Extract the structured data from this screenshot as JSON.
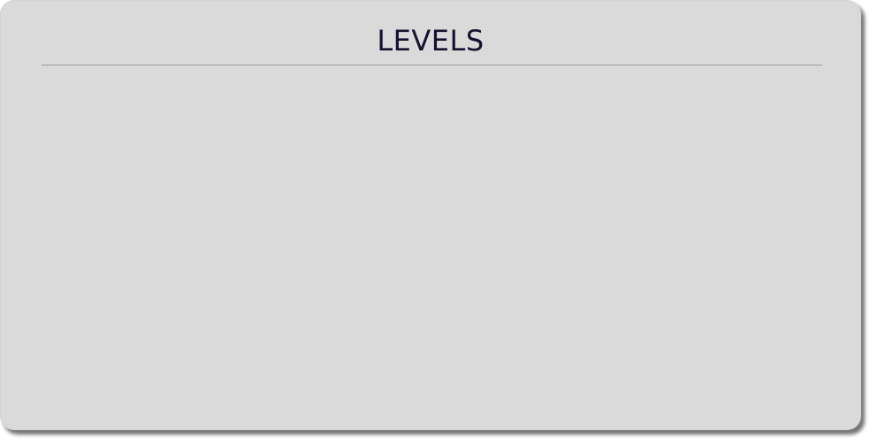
{
  "panel": {
    "title": "LEVELS",
    "colors": {
      "background": "#dadada",
      "title": "#14112e",
      "divider": "#9b9b9b"
    }
  }
}
